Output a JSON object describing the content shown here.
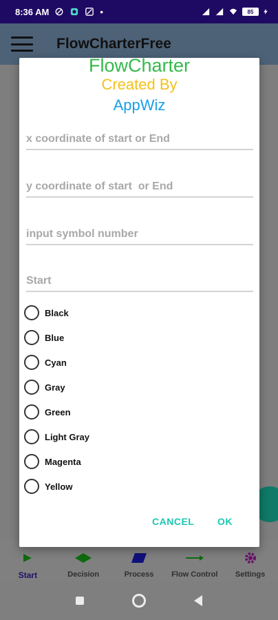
{
  "status_bar": {
    "time": "8:36 AM",
    "battery": "85"
  },
  "app_bar": {
    "title": "FlowCharterFree"
  },
  "dialog": {
    "title_line1": "FlowCharter",
    "title_line2": "Created By",
    "title_line3": "AppWiz",
    "title_colors": [
      "#35b94a",
      "#f2c21b",
      "#1a9fe8"
    ],
    "fields": [
      {
        "placeholder": "x coordinate of start or End",
        "value": ""
      },
      {
        "placeholder": "y coordinate of start  or End",
        "value": ""
      },
      {
        "placeholder": "input symbol number",
        "value": ""
      },
      {
        "placeholder": "Start",
        "value": ""
      }
    ],
    "color_options": [
      "Black",
      "Blue",
      "Cyan",
      "Gray",
      "Green",
      "Light Gray",
      "Magenta",
      "Yellow"
    ],
    "selected_color": null,
    "cancel_label": "CANCEL",
    "ok_label": "OK",
    "accent_color": "#1bc7b0"
  },
  "bottom_nav": {
    "items": [
      {
        "label": "Start",
        "icon": "play-triangle-icon"
      },
      {
        "label": "Decision",
        "icon": "diamond-icon"
      },
      {
        "label": "Process",
        "icon": "parallelogram-icon"
      },
      {
        "label": "Flow Control",
        "icon": "arrow-right-icon"
      },
      {
        "label": "Settings",
        "icon": "gear-icon"
      }
    ],
    "active": "Start"
  }
}
